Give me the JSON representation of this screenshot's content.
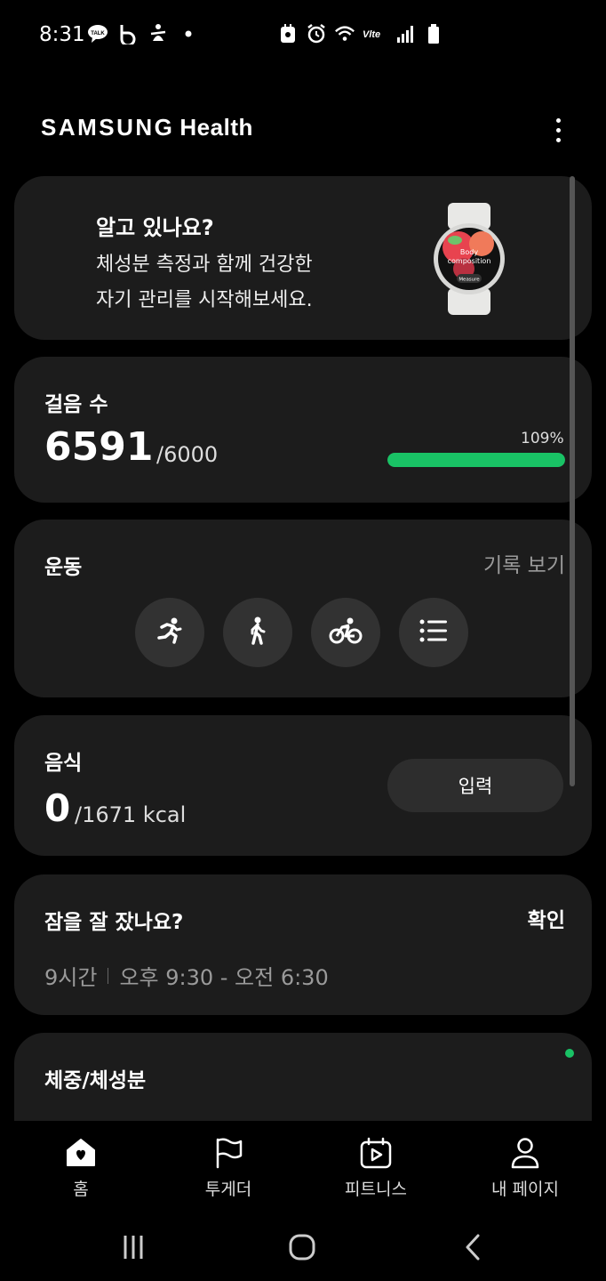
{
  "status_bar": {
    "time": "8:31",
    "left_icons": [
      "talk-icon",
      "b-icon",
      "accessibility-icon",
      "dot-icon"
    ],
    "right_icons": [
      "nfc-icon",
      "alarm-icon",
      "wifi-icon",
      "volte-icon",
      "signal-icon",
      "battery-icon"
    ]
  },
  "header": {
    "brand": "SAMSUNG",
    "product": "Health"
  },
  "tip": {
    "title": "알고 있나요?",
    "line1": "체성분 측정과 함께 건강한",
    "line2": "자기 관리를 시작해보세요.",
    "watch_text1": "Body",
    "watch_text2": "composition",
    "watch_button": "Measure"
  },
  "steps": {
    "title": "걸음 수",
    "value": "6591",
    "goal": "/6000",
    "percent": "109%",
    "progress_fraction": 1.0
  },
  "exercise": {
    "title": "운동",
    "link": "기록 보기",
    "buttons": [
      "running-icon",
      "walking-icon",
      "cycling-icon",
      "list-icon"
    ]
  },
  "food": {
    "title": "음식",
    "value": "0",
    "goal": "/1671 kcal",
    "input_label": "입력"
  },
  "sleep": {
    "title": "잠을 잘 잤나요?",
    "confirm": "확인",
    "duration": "9시간",
    "range": "오후 9:30 - 오전 6:30"
  },
  "weight": {
    "title": "체중/체성분"
  },
  "bottom_nav": [
    {
      "label": "홈",
      "icon": "home-icon"
    },
    {
      "label": "투게더",
      "icon": "flag-icon"
    },
    {
      "label": "피트니스",
      "icon": "fitness-icon"
    },
    {
      "label": "내 페이지",
      "icon": "person-icon"
    }
  ],
  "colors": {
    "background": "#000000",
    "card": "#1c1c1c",
    "accent_green": "#19c265",
    "muted_text": "#9a9a9a"
  }
}
